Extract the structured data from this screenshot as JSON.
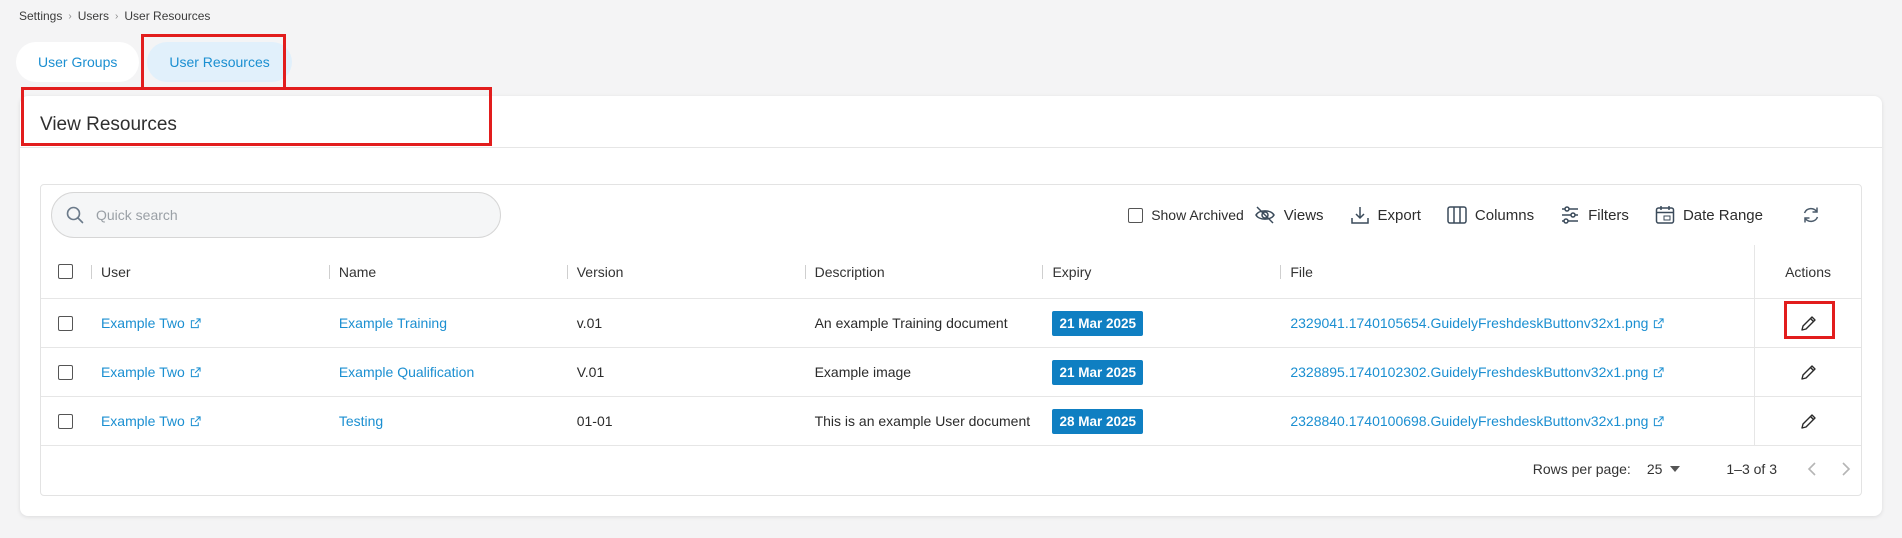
{
  "breadcrumb": [
    "Settings",
    "Users",
    "User Resources"
  ],
  "tabs": [
    {
      "label": "User Groups",
      "active": false
    },
    {
      "label": "User Resources",
      "active": true
    }
  ],
  "card": {
    "title": "View Resources"
  },
  "search": {
    "placeholder": "Quick search",
    "value": ""
  },
  "toolbar": {
    "show_archived": "Show Archived",
    "views": "Views",
    "export": "Export",
    "columns": "Columns",
    "filters": "Filters",
    "date_range": "Date Range"
  },
  "table": {
    "headers": {
      "user": "User",
      "name": "Name",
      "version": "Version",
      "description": "Description",
      "expiry": "Expiry",
      "file": "File",
      "actions": "Actions"
    },
    "rows": [
      {
        "user": "Example Two",
        "name": "Example Training",
        "version": "v.01",
        "description": "An example Training document",
        "expiry": "21 Mar 2025",
        "file": "2329041.1740105654.GuidelyFreshdeskButtonv32x1.png"
      },
      {
        "user": "Example Two",
        "name": "Example Qualification",
        "version": "V.01",
        "description": "Example image",
        "expiry": "21 Mar 2025",
        "file": "2328895.1740102302.GuidelyFreshdeskButtonv32x1.png"
      },
      {
        "user": "Example Two",
        "name": "Testing",
        "version": "01-01",
        "description": "This is an example User document",
        "expiry": "28 Mar 2025",
        "file": "2328840.1740100698.GuidelyFreshdeskButtonv32x1.png"
      }
    ]
  },
  "pagination": {
    "rows_per_page_label": "Rows per page:",
    "rows_per_page": "25",
    "range": "1–3 of 3"
  },
  "colors": {
    "accent": "#1b8fd1",
    "badge": "#0f7fc2",
    "highlight": "#e21d1d"
  }
}
